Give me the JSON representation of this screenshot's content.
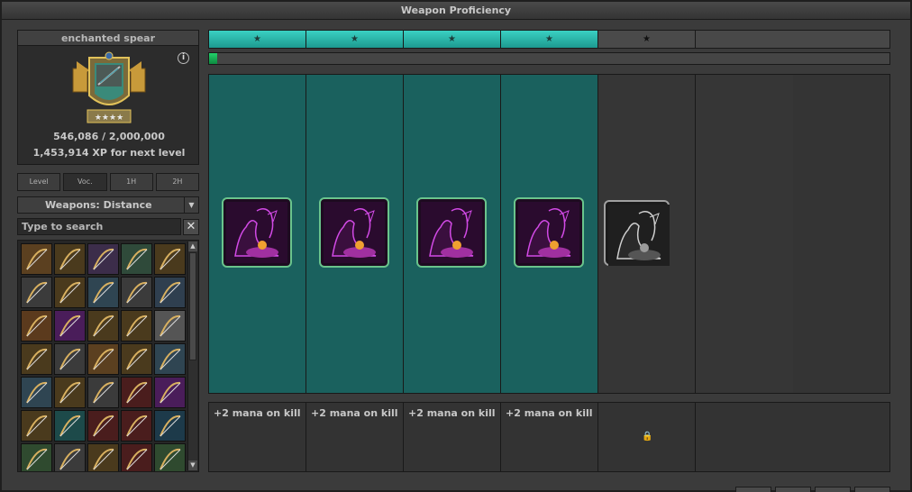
{
  "window": {
    "title": "Weapon Proficiency"
  },
  "weapon": {
    "name": "enchanted spear",
    "info_icon": "info-icon",
    "xp_progress": "546,086 / 2,000,000",
    "xp_next": "1,453,914 XP for next level"
  },
  "tabs": [
    "Level",
    "Voc.",
    "1H",
    "2H"
  ],
  "filter": {
    "selected": "Weapons: Distance",
    "arrow": "▼"
  },
  "search": {
    "placeholder": "Type to search",
    "clear": "✕"
  },
  "weapon_grid_colors": [
    "#5b4020",
    "#4a3a1d",
    "#3c2d4a",
    "#2f4a3a",
    "#4a3a1d",
    "#3b3b3b",
    "#4a3a1d",
    "#2f4552",
    "#3b3b3b",
    "#2f3f4f",
    "#5b3a1d",
    "#4a1d5a",
    "#4a3a1d",
    "#4a3a1d",
    "#555555",
    "#4a3a1d",
    "#3b3b3b",
    "#5b4020",
    "#4a3a1d",
    "#2f4552",
    "#2f4552",
    "#4a3a1d",
    "#3b3b3b",
    "#4a1d1d",
    "#4a1d5a",
    "#4a3a1d",
    "#1d4a4a",
    "#4a1d1d",
    "#4a1d1d",
    "#1d3a4a",
    "#2f4a2f",
    "#3b3b3b",
    "#4a3a1d",
    "#4a1d1d",
    "#2f4a2f"
  ],
  "levels": {
    "star": "★",
    "completed": 4,
    "total": 5
  },
  "progress": {
    "fraction": 0.012
  },
  "perks": [
    {
      "unlocked": true,
      "text": "+2 mana on kill"
    },
    {
      "unlocked": true,
      "text": "+2 mana on kill"
    },
    {
      "unlocked": true,
      "text": "+2 mana on kill"
    },
    {
      "unlocked": true,
      "text": "+2 mana on kill"
    },
    {
      "unlocked": false,
      "text": "",
      "lock": "🔒"
    }
  ],
  "colors": {
    "teal": "#1a615e",
    "teal_bar": "#2ebfb2",
    "green_progress": "#1bbf5c",
    "perk_border": "#6ac48c"
  }
}
